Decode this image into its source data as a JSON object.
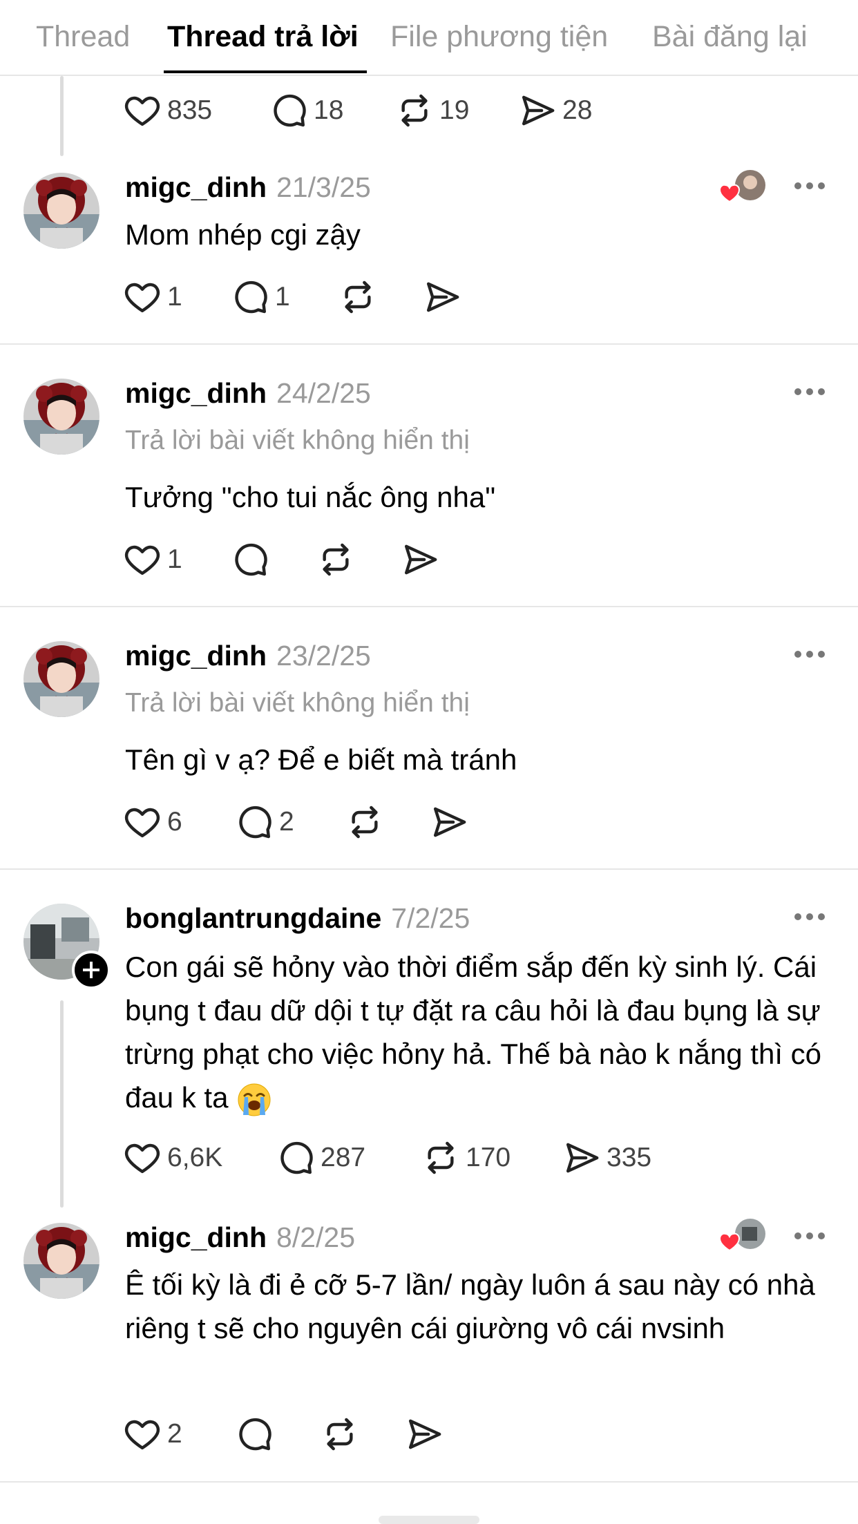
{
  "tabs": [
    {
      "label": "Thread",
      "active": false
    },
    {
      "label": "Thread trả lời",
      "active": true
    },
    {
      "label": "File phương tiện",
      "active": false
    },
    {
      "label": "Bài đăng lại",
      "active": false
    }
  ],
  "top_actions": {
    "likes": "835",
    "replies": "18",
    "reposts": "19",
    "shares": "28"
  },
  "posts": [
    {
      "username": "migc_dinh",
      "date": "21/3/25",
      "context": "",
      "text": "Mom nhép cgi zậy",
      "likes": "1",
      "replies": "1",
      "reposts": "",
      "shares": "",
      "liked_by_author": true
    },
    {
      "username": "migc_dinh",
      "date": "24/2/25",
      "context": "Trả lời bài viết không hiển thị",
      "text": "Tưởng \"cho tui nắc ông nha\"",
      "likes": "1",
      "replies": "",
      "reposts": "",
      "shares": "",
      "liked_by_author": false
    },
    {
      "username": "migc_dinh",
      "date": "23/2/25",
      "context": "Trả lời bài viết không hiển thị",
      "text": "Tên gì v ạ? Để e biết mà tránh",
      "likes": "6",
      "replies": "2",
      "reposts": "",
      "shares": "",
      "liked_by_author": false
    },
    {
      "username": "bonglantrungdaine",
      "date": "7/2/25",
      "context": "",
      "text": "Con gái sẽ hỏny vào thời điểm sắp đến kỳ sinh lý. Cái bụng t đau dữ dội t tự đặt ra câu hỏi là đau bụng là sự trừng phạt cho việc hỏny hả. Thế bà nào k nắng thì có đau k ta",
      "emoji": "loudly-crying-face",
      "likes": "6,6K",
      "replies": "287",
      "reposts": "170",
      "shares": "335",
      "liked_by_author": false
    },
    {
      "username": "migc_dinh",
      "date": "8/2/25",
      "context": "",
      "text": "Ê tối kỳ là đi ẻ cỡ 5-7 lần/ ngày luôn á sau này có nhà riêng t sẽ cho nguyên cái giường vô cái nvsinh",
      "likes": "2",
      "replies": "",
      "reposts": "",
      "shares": "",
      "liked_by_author": true
    }
  ],
  "colors": {
    "text": "#000000",
    "muted": "#9a9a9a",
    "divider": "#e6e6e6",
    "heart": "#ff3040"
  }
}
